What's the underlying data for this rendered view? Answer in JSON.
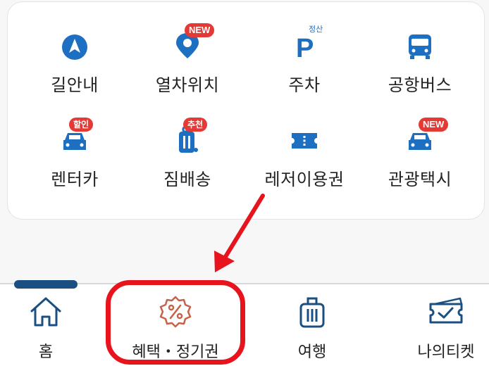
{
  "services": [
    {
      "label": "길안내",
      "icon": "navigation-icon"
    },
    {
      "label": "열차위치",
      "icon": "location-pin-icon",
      "badge": "NEW"
    },
    {
      "label": "주차",
      "icon": "parking-icon",
      "superscript": "정산"
    },
    {
      "label": "공항버스",
      "icon": "bus-icon"
    },
    {
      "label": "렌터카",
      "icon": "car-icon",
      "badge": "할인"
    },
    {
      "label": "짐배송",
      "icon": "luggage-icon",
      "badge": "추천"
    },
    {
      "label": "레저이용권",
      "icon": "ticket-icon"
    },
    {
      "label": "관광택시",
      "icon": "taxi-icon",
      "badge": "NEW"
    }
  ],
  "nav": [
    {
      "label": "홈",
      "icon": "home-icon"
    },
    {
      "label": "혜택・정기권",
      "icon": "discount-icon"
    },
    {
      "label": "여행",
      "icon": "suitcase-icon"
    },
    {
      "label": "나의티켓",
      "icon": "my-ticket-icon"
    }
  ],
  "colors": {
    "icon_blue": "#1d6fc2",
    "badge_red": "#e53935",
    "annotation_red": "#e8141d",
    "nav_icon": "#1b4f82",
    "discount_icon": "#c7624a"
  }
}
